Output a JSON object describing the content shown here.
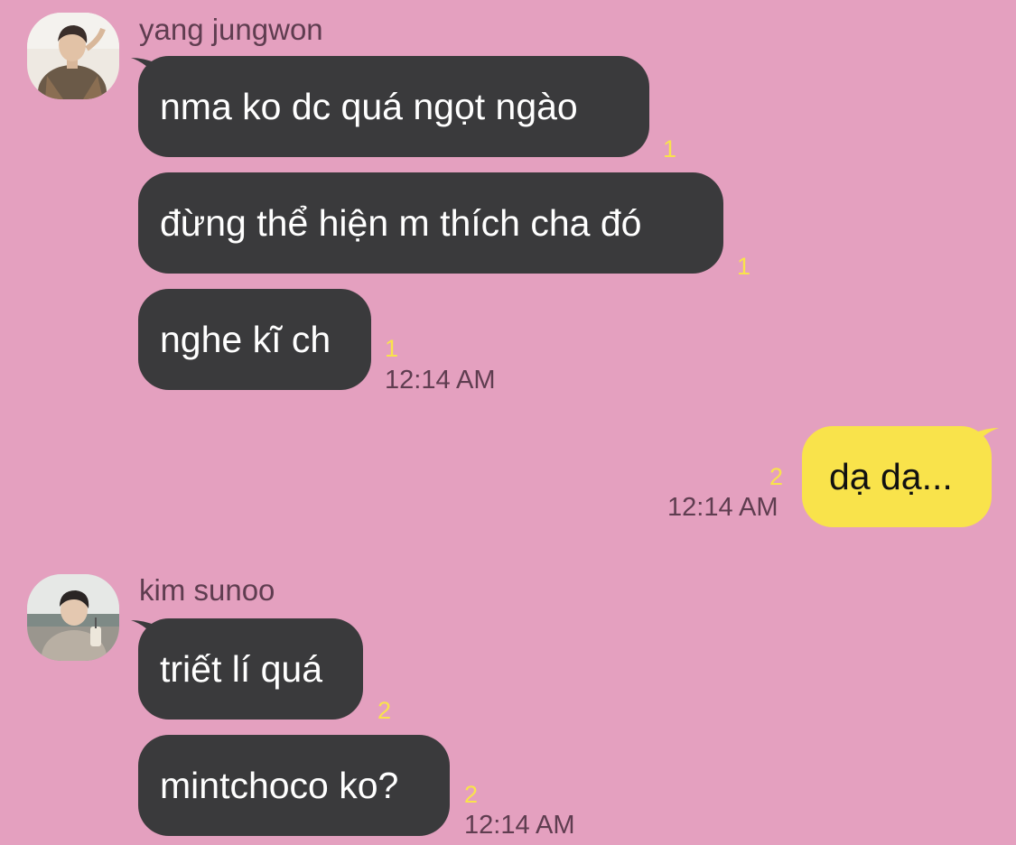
{
  "colors": {
    "background": "#E4A0BF",
    "incoming_bubble": "#3A3A3C",
    "outgoing_bubble": "#F9E34B",
    "unread_count": "#F9E34B"
  },
  "messages": {
    "jungwon": {
      "sender": "yang jungwon",
      "avatar_icon": "profile-photo",
      "msg1": "nma ko dc quá ngọt ngào",
      "msg1_unread": "1",
      "msg2": "đừng thể hiện m thích cha đó",
      "msg2_unread": "1",
      "msg3": "nghe kĩ ch",
      "msg3_unread": "1",
      "time": "12:14 AM"
    },
    "me": {
      "msg1": "dạ dạ...",
      "msg1_unread": "2",
      "time": "12:14 AM"
    },
    "sunoo": {
      "sender": "kim sunoo",
      "avatar_icon": "profile-photo",
      "msg1": "triết lí quá",
      "msg1_unread": "2",
      "msg2": "mintchoco ko?",
      "msg2_unread": "2",
      "time": "12:14 AM"
    }
  }
}
